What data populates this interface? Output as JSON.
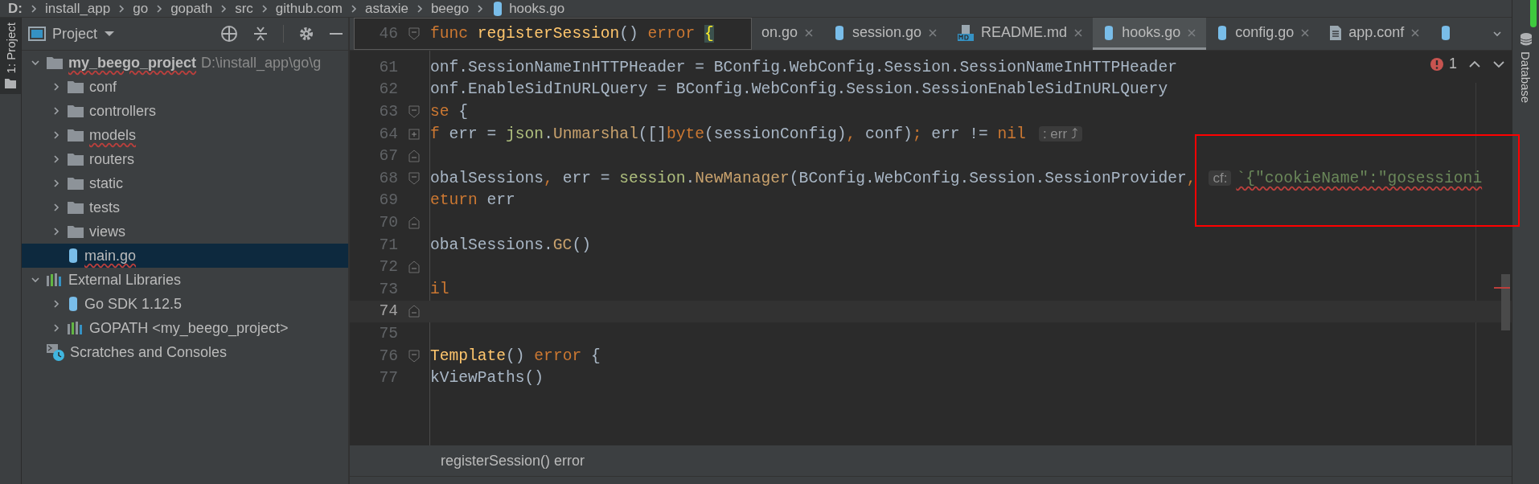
{
  "breadcrumbs": [
    {
      "label": "D:",
      "kind": "drive"
    },
    {
      "label": "install_app",
      "kind": "dir"
    },
    {
      "label": "go",
      "kind": "dir"
    },
    {
      "label": "gopath",
      "kind": "dir"
    },
    {
      "label": "src",
      "kind": "dir"
    },
    {
      "label": "github.com",
      "kind": "dir"
    },
    {
      "label": "astaxie",
      "kind": "dir"
    },
    {
      "label": "beego",
      "kind": "dir"
    },
    {
      "label": "hooks.go",
      "kind": "gofile"
    }
  ],
  "left_tool_tab": {
    "label": "1: Project",
    "selected": true
  },
  "right_tool_tab": {
    "label": "Database"
  },
  "project_panel": {
    "title": "Project",
    "tree": [
      {
        "label": "my_beego_project",
        "hint": "D:\\install_app\\go\\g",
        "kind": "folder",
        "bold": true,
        "expanded": true,
        "selected": false,
        "spell_error": true,
        "children": [
          {
            "label": "conf",
            "kind": "folder",
            "expanded": false,
            "selected": false,
            "spell_error": false
          },
          {
            "label": "controllers",
            "kind": "folder",
            "expanded": false,
            "selected": false,
            "spell_error": false
          },
          {
            "label": "models",
            "kind": "folder",
            "expanded": false,
            "selected": false,
            "spell_error": true
          },
          {
            "label": "routers",
            "kind": "folder",
            "expanded": false,
            "selected": false,
            "spell_error": false
          },
          {
            "label": "static",
            "kind": "folder",
            "expanded": false,
            "selected": false,
            "spell_error": false
          },
          {
            "label": "tests",
            "kind": "folder",
            "expanded": false,
            "selected": false,
            "spell_error": false
          },
          {
            "label": "views",
            "kind": "folder",
            "expanded": false,
            "selected": false,
            "spell_error": false
          },
          {
            "label": "main.go",
            "kind": "gofile",
            "selected": true,
            "spell_error": true
          }
        ]
      },
      {
        "label": "External Libraries",
        "kind": "library",
        "expanded": true,
        "selected": false,
        "spell_error": false,
        "children": [
          {
            "label": "Go SDK 1.12.5",
            "kind": "gofile",
            "expanded": false,
            "selected": false,
            "spell_error": false
          },
          {
            "label": "GOPATH <my_beego_project>",
            "kind": "library",
            "expanded": false,
            "selected": false,
            "spell_error": false
          }
        ]
      },
      {
        "label": "Scratches and Consoles",
        "kind": "scratches",
        "selected": false,
        "spell_error": false
      }
    ]
  },
  "editor": {
    "sticky_header": {
      "line_number": "46",
      "code": [
        {
          "text": "func ",
          "kind": "kw"
        },
        {
          "text": "registerSession",
          "kind": "fn"
        },
        {
          "text": "() ",
          "kind": "plain"
        },
        {
          "text": "error ",
          "kind": "kw"
        },
        {
          "text": "{",
          "kind": "brace"
        }
      ]
    },
    "tabs": [
      {
        "label": "on.go",
        "kind": "plain",
        "selected": false
      },
      {
        "label": "session.go",
        "kind": "gofile",
        "selected": false
      },
      {
        "label": "README.md",
        "kind": "markdown",
        "selected": false
      },
      {
        "label": "hooks.go",
        "kind": "gofile",
        "selected": true
      },
      {
        "label": "config.go",
        "kind": "gofile",
        "selected": false
      },
      {
        "label": "app.conf",
        "kind": "text",
        "selected": false
      },
      {
        "kind": "gofile",
        "selected": false
      }
    ],
    "error_count": "1",
    "lines": [
      {
        "number": "61",
        "current": false,
        "kind": "plain",
        "code": [
          {
            "text": "onf.SessionNameInHTTPHeader = BConfig.WebConfig.Session.SessionNameInHTTPHeader",
            "kind": "plain"
          }
        ]
      },
      {
        "number": "62",
        "current": false,
        "kind": "plain",
        "code": [
          {
            "text": "onf.EnableSidInURLQuery = BConfig.WebConfig.Session.SessionEnableSidInURLQuery",
            "kind": "plain"
          }
        ]
      },
      {
        "number": "63",
        "current": false,
        "kind": "fold_start",
        "code": [
          {
            "text": "se",
            "kind": "kw"
          },
          {
            "text": " {",
            "kind": "plain"
          }
        ]
      },
      {
        "number": "64",
        "current": false,
        "kind": "fold_collapsed",
        "code": [
          {
            "text": "f",
            "kind": "kw"
          },
          {
            "text": " err = ",
            "kind": "plain"
          },
          {
            "text": "json",
            "kind": "pkg"
          },
          {
            "text": ".",
            "kind": "plain"
          },
          {
            "text": "Unmarshal",
            "kind": "call"
          },
          {
            "text": "([]",
            "kind": "plain"
          },
          {
            "text": "byte",
            "kind": "kw"
          },
          {
            "text": "(sessionConfig)",
            "kind": "plain"
          },
          {
            "text": ",",
            "kind": "kw"
          },
          {
            "text": " conf)",
            "kind": "plain"
          },
          {
            "text": ";",
            "kind": "kw"
          },
          {
            "text": " err != ",
            "kind": "plain"
          },
          {
            "text": "nil",
            "kind": "kw"
          },
          {
            "text": ": err ⤴",
            "kind": "hint"
          }
        ]
      },
      {
        "number": "67",
        "current": false,
        "kind": "fold_end"
      },
      {
        "number": "68",
        "current": false,
        "kind": "fold_start",
        "code": [
          {
            "text": "obalSessions",
            "kind": "plain"
          },
          {
            "text": ",",
            "kind": "kw"
          },
          {
            "text": " err = ",
            "kind": "plain"
          },
          {
            "text": "session",
            "kind": "pkg"
          },
          {
            "text": ".",
            "kind": "plain"
          },
          {
            "text": "NewManager",
            "kind": "call"
          },
          {
            "text": "(BConfig.WebConfig.Session.SessionProvider",
            "kind": "plain"
          },
          {
            "text": ",",
            "kind": "kw"
          },
          {
            "text": "cf:",
            "kind": "hint"
          },
          {
            "text": "`{\"cookieName\":\"gosessioni",
            "kind": "str_warn"
          }
        ]
      },
      {
        "number": "69",
        "current": false,
        "kind": "plain",
        "code": [
          {
            "text": "eturn",
            "kind": "kw"
          },
          {
            "text": " err",
            "kind": "plain"
          }
        ]
      },
      {
        "number": "70",
        "current": false,
        "kind": "fold_end"
      },
      {
        "number": "71",
        "current": false,
        "kind": "plain",
        "code": [
          {
            "text": "obalSessions.",
            "kind": "plain"
          },
          {
            "text": "GC",
            "kind": "call"
          },
          {
            "text": "()",
            "kind": "plain"
          }
        ]
      },
      {
        "number": "72",
        "current": false,
        "kind": "fold_end"
      },
      {
        "number": "73",
        "current": false,
        "kind": "plain",
        "code": [
          {
            "text": "il",
            "kind": "kw"
          }
        ]
      },
      {
        "number": "74",
        "current": true,
        "kind": "fold_end"
      },
      {
        "number": "75",
        "current": false,
        "kind": "plain"
      },
      {
        "number": "76",
        "current": false,
        "kind": "fold_start",
        "code": [
          {
            "text": "Template",
            "kind": "fn"
          },
          {
            "text": "() ",
            "kind": "plain"
          },
          {
            "text": "error",
            "kind": "kw"
          },
          {
            "text": " {",
            "kind": "plain"
          }
        ]
      },
      {
        "number": "77",
        "current": false,
        "kind": "plain",
        "code": [
          {
            "text": "kViewPaths()",
            "kind": "plain"
          }
        ]
      }
    ],
    "doc_popup": "registerSession() error"
  }
}
